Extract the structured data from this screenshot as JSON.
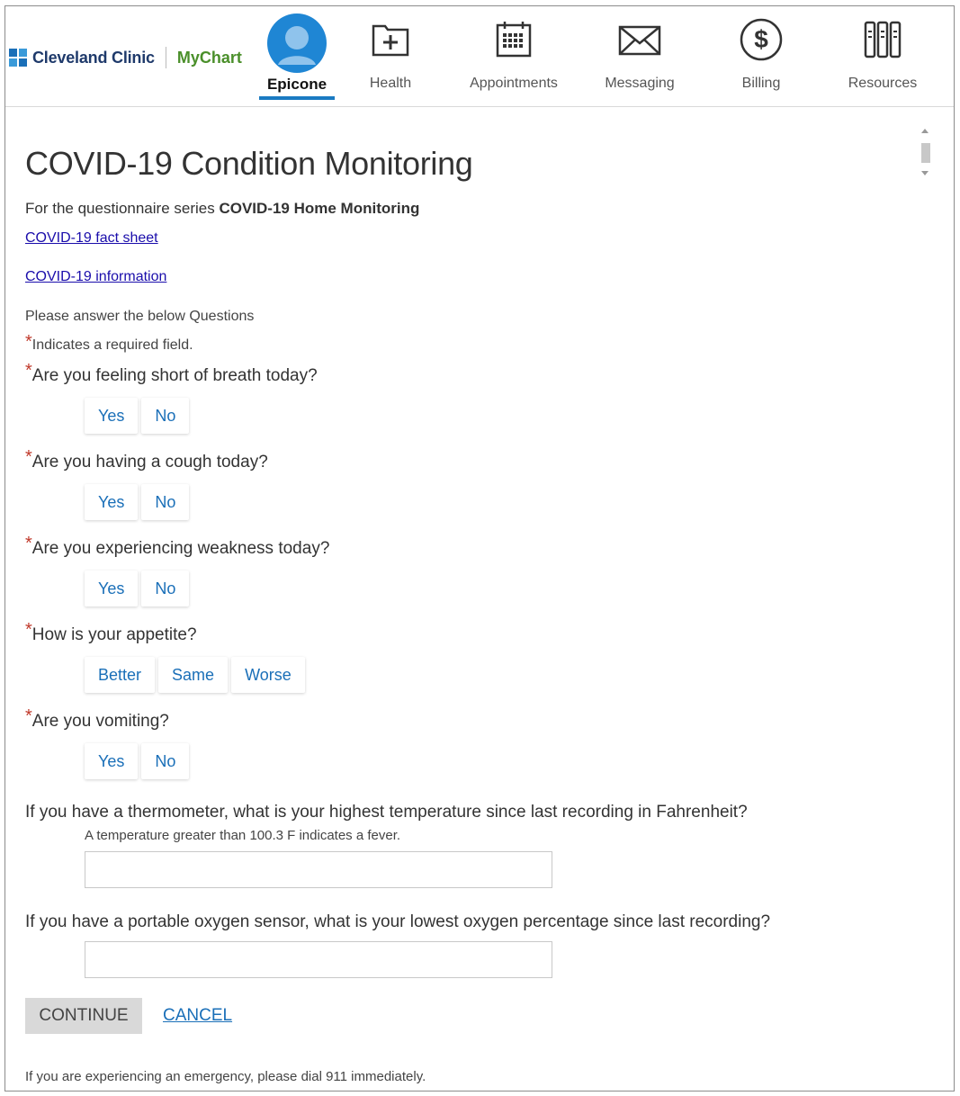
{
  "header": {
    "brand": "Cleveland Clinic",
    "product": "MyChart",
    "nav": [
      {
        "label": "Epicone",
        "icon": "user-avatar-icon",
        "active": true
      },
      {
        "label": "Health",
        "icon": "health-folder-icon"
      },
      {
        "label": "Appointments",
        "icon": "calendar-icon"
      },
      {
        "label": "Messaging",
        "icon": "envelope-icon"
      },
      {
        "label": "Billing",
        "icon": "dollar-icon"
      },
      {
        "label": "Resources",
        "icon": "library-icon"
      }
    ]
  },
  "page": {
    "title": "COVID-19 Condition Monitoring",
    "series_prefix": "For the questionnaire series ",
    "series_name": "COVID-19 Home Monitoring",
    "link1": "COVID-19 fact sheet",
    "link2": "COVID-19 information",
    "instructions": "Please answer the below Questions",
    "required_note": "Indicates a required field."
  },
  "questions": [
    {
      "text": "Are you feeling short of breath today?",
      "options": [
        "Yes",
        "No"
      ]
    },
    {
      "text": "Are you having a cough today?",
      "options": [
        "Yes",
        "No"
      ]
    },
    {
      "text": "Are you experiencing weakness today?",
      "options": [
        "Yes",
        "No"
      ]
    },
    {
      "text": "How is your appetite?",
      "options": [
        "Better",
        "Same",
        "Worse"
      ]
    },
    {
      "text": "Are you vomiting?",
      "options": [
        "Yes",
        "No"
      ]
    }
  ],
  "temperature": {
    "question": "If you have a thermometer, what is your highest temperature since last recording in Fahrenheit?",
    "hint": "A temperature greater than 100.3 F indicates a fever.",
    "value": ""
  },
  "oxygen": {
    "question": "If you have a portable oxygen sensor, what is your lowest oxygen percentage since last recording?",
    "value": ""
  },
  "actions": {
    "continue": "CONTINUE",
    "cancel": "CANCEL"
  },
  "footer": "If you are experiencing an emergency, please dial 911 immediately.",
  "colors": {
    "accent": "#1a7ac2",
    "link": "#1a0dab",
    "required": "#c0392b",
    "brand_green": "#4a8f2a"
  }
}
